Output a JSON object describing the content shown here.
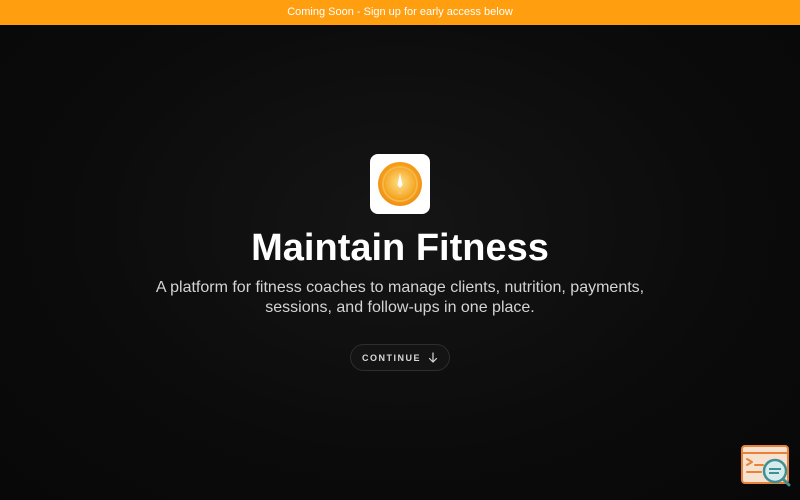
{
  "banner": {
    "text": "Coming Soon - Sign up for early access below"
  },
  "hero": {
    "title": "Maintain Fitness",
    "subtitle": "A platform for fitness coaches to manage clients, nutrition, payments, sessions, and follow-ups in one place.",
    "continue_label": "CONTINUE",
    "continue_icon": "arrow-down-icon"
  },
  "logo": {
    "icon": "compass-icon"
  },
  "widget": {
    "icon": "terminal-search-icon"
  },
  "colors": {
    "banner": "#ff9f0f",
    "background": "#0a0a0a",
    "logo_orange": "#f39a1a",
    "widget_orange": "#e8823a",
    "widget_teal": "#3f8f94"
  }
}
